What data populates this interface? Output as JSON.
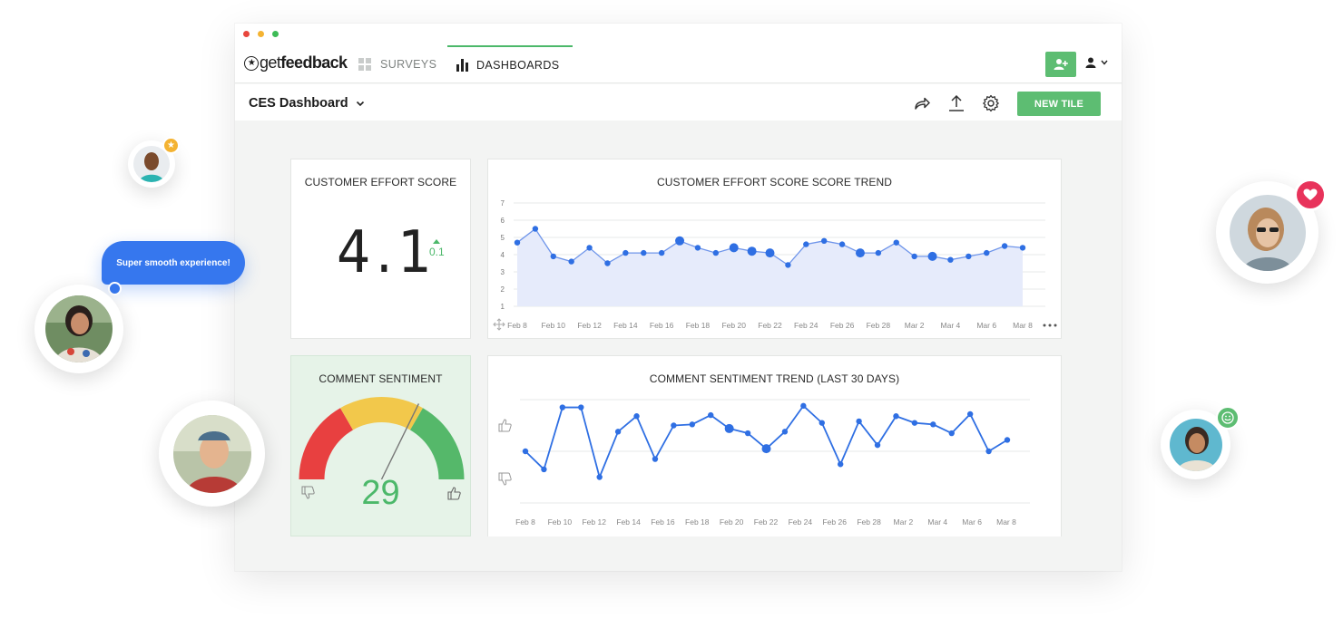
{
  "app": {
    "logo_part1": "get",
    "logo_part2": "feedback",
    "nav": {
      "surveys": "SURVEYS",
      "dashboards": "DASHBOARDS"
    },
    "dashboard_title": "CES Dashboard",
    "new_tile_label": "NEW TILE"
  },
  "colors": {
    "accent_green": "#5dbd72",
    "line_blue": "#2f6fe3",
    "area_fill": "#e6ebfb",
    "gauge_red": "#e84040",
    "gauge_yellow": "#f2c84b",
    "gauge_green": "#55b86a",
    "sentiment_bg": "#e6f3e8"
  },
  "icons": {
    "logo": "star-circle-icon",
    "surveys": "grid-icon",
    "dashboards": "bar-chart-icon",
    "add_user": "add-user-icon",
    "user": "user-icon",
    "share": "share-arrow-icon",
    "export": "upload-icon",
    "settings": "gear-icon",
    "move": "move-arrows-icon",
    "more": "ellipsis-icon",
    "thumbs_up": "thumbs-up-icon",
    "thumbs_down": "thumbs-down-icon"
  },
  "ces_tile": {
    "title": "CUSTOMER EFFORT SCORE",
    "value": "4.1",
    "delta": "0.1"
  },
  "sentiment_tile": {
    "title": "COMMENT SENTIMENT",
    "value": "29"
  },
  "chat_bubble": "Super smooth experience!",
  "chart_data": [
    {
      "type": "area",
      "title": "CUSTOMER EFFORT SCORE SCORE TREND",
      "ylim": [
        1,
        7
      ],
      "yticks": [
        1,
        2,
        3,
        4,
        5,
        6,
        7
      ],
      "xticks": [
        "Feb 8",
        "Feb 10",
        "Feb 12",
        "Feb 14",
        "Feb 16",
        "Feb 18",
        "Feb 20",
        "Feb 22",
        "Feb 24",
        "Feb 26",
        "Feb 28",
        "Mar 2",
        "Mar 4",
        "Mar 6",
        "Mar 8"
      ],
      "grid": true,
      "values": [
        4.7,
        5.5,
        3.9,
        3.6,
        4.4,
        3.5,
        4.1,
        4.1,
        4.1,
        4.8,
        4.4,
        4.1,
        4.4,
        4.2,
        4.1,
        3.4,
        4.6,
        4.8,
        4.6,
        4.1,
        4.1,
        4.7,
        3.9,
        3.9,
        3.7,
        3.9,
        4.1,
        4.5,
        4.4
      ],
      "large_points": [
        9,
        12,
        13,
        14,
        19,
        23
      ]
    },
    {
      "type": "line",
      "title": "COMMENT SENTIMENT TREND (LAST 30 DAYS)",
      "ylim": [
        -1,
        1
      ],
      "xticks": [
        "Feb 8",
        "Feb 10",
        "Feb 12",
        "Feb 14",
        "Feb 16",
        "Feb 18",
        "Feb 20",
        "Feb 22",
        "Feb 24",
        "Feb 26",
        "Feb 28",
        "Mar 2",
        "Mar 4",
        "Mar 6",
        "Mar 8"
      ],
      "grid": true,
      "values": [
        0.0,
        -0.35,
        0.85,
        0.85,
        -0.5,
        0.38,
        0.68,
        -0.15,
        0.5,
        0.52,
        0.7,
        0.44,
        0.35,
        0.05,
        0.38,
        0.88,
        0.55,
        -0.25,
        0.58,
        0.12,
        0.68,
        0.55,
        0.52,
        0.35,
        0.72,
        0.0,
        0.22
      ],
      "large_points": [
        11,
        13
      ]
    }
  ]
}
